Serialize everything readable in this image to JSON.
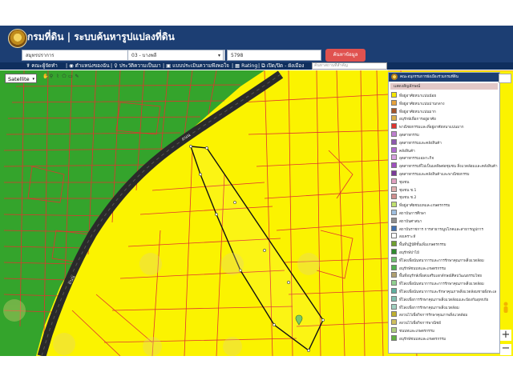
{
  "header": {
    "title": "กรมที่ดิน | ระบบค้นหารูปแปลงที่ดิน",
    "province_select": "สมุทรปราการ",
    "district_select": "03 - บางพลี",
    "parcel_number": "5798",
    "search_button": "ค้นหาข้อมูล"
  },
  "menu": {
    "items": [
      "คณะผู้จัดทำ",
      "ตำแหน่งของฉัน",
      "ประวัติความเป็นมา",
      "แบบประเมินความพึงพอใจ",
      "Rating",
      "เปิด/ปิด - ผังเมือง"
    ],
    "search_placeholder": "ค้นหาสถานที่สำคัญ"
  },
  "map": {
    "basemap_select": "Satellite",
    "road_label": "ถนน",
    "colors": {
      "zone_yellow": "#fbf300",
      "zone_green": "#34a42c",
      "parcel_lines": "#e0342f",
      "road": "#2a2a2a",
      "highlight": "#111111"
    }
  },
  "legend": {
    "title": "คณะอนุกรรมการผังเมืองร่วมกรมที่ดิน",
    "subtitle": "แสดงสัญลักษณ์",
    "items": [
      {
        "label": "ที่อยู่อาศัยหนาแน่นน้อย",
        "color": "#f5e700"
      },
      {
        "label": "ที่อยู่อาศัยหนาแน่นปานกลาง",
        "color": "#e6a23c"
      },
      {
        "label": "ที่อยู่อาศัยหนาแน่นมาก",
        "color": "#a5552a"
      },
      {
        "label": "อนุรักษ์เพื่อการอยู่อาศัย",
        "color": "#d9b04a"
      },
      {
        "label": "พาณิชยกรรมและที่อยู่อาศัยหนาแน่นมาก",
        "color": "#e0342f"
      },
      {
        "label": "อุตสาหกรรม",
        "color": "#c080d0"
      },
      {
        "label": "อุตสาหกรรมและคลังสินค้า",
        "color": "#8e5ab0"
      },
      {
        "label": "คลังสินค้า",
        "color": "#b06ad0"
      },
      {
        "label": "อุตสาหกรรมเฉพาะกิจ",
        "color": "#d8a0e0"
      },
      {
        "label": "อุตสาหกรรมที่ไม่เป็นมลพิษต่อชุมชน สิ่งแวดล้อมและคลังสินค้า",
        "color": "#a050c0"
      },
      {
        "label": "อุตสาหกรรมและคลังสินค้าและพาณิชยกรรม",
        "color": "#7a3a9a"
      },
      {
        "label": "ชุมชน",
        "color": "#e0a0c0"
      },
      {
        "label": "ชุมชน ช.1",
        "color": "#e0b0b0"
      },
      {
        "label": "ชุมชน ช.2",
        "color": "#d09090"
      },
      {
        "label": "ที่อยู่อาศัยชนบทและเกษตรกรรม",
        "color": "#c0e070"
      },
      {
        "label": "สถาบันการศึกษา",
        "color": "#a0c0e0"
      },
      {
        "label": "สถาบันศาสนา",
        "color": "#909090"
      },
      {
        "label": "สถาบันราชการ การสาธารณูปโภคและสาธารณูปการ",
        "color": "#4070b0"
      },
      {
        "label": "สงเคราะห์",
        "color": "#ffffff"
      },
      {
        "label": "พื้นที่ปฏิบัติชั้นเพิ่มเกษตรกรรม",
        "color": "#70a030"
      },
      {
        "label": "อนุรักษ์ป่าไม้",
        "color": "#2f8a2f"
      },
      {
        "label": "ที่โล่งเพื่อนันทนาการและการรักษาคุณภาพสิ่งแวดล้อม",
        "color": "#70c070"
      },
      {
        "label": "อนุรักษ์ชนบทและเกษตรกรรม",
        "color": "#50b050"
      },
      {
        "label": "พื้นที่อนุรักษ์เพื่อส่งเสริมเอกลักษณ์ศิลปวัฒนธรรมไทย",
        "color": "#b0a070"
      },
      {
        "label": "ที่โล่งเพื่อนันทนาการและการรักษาคุณภาพสิ่งแวดล้อม",
        "color": "#90d090"
      },
      {
        "label": "ที่โล่งเพื่อนันทนาการและรักษาคุณภาพสิ่งแวดล้อมชายฝั่งทะเล",
        "color": "#60b0a0"
      },
      {
        "label": "ที่โล่งเพื่อการรักษาคุณภาพสิ่งแวดล้อมและป้องกันอุทกภัย",
        "color": "#80c0b0"
      },
      {
        "label": "ที่โล่งเพื่อการรักษาคุณภาพสิ่งแวดล้อม",
        "color": "#a0d0c0"
      },
      {
        "label": "สงวนไว้เพื่อกิจการรักษาคุณภาพสิ่งแวดล้อม",
        "color": "#c0b030"
      },
      {
        "label": "สงวนไว้เพื่อกิจการพาณิชย์",
        "color": "#d0c060"
      },
      {
        "label": "ชนบทและเกษตรกรรม",
        "color": "#b0d080"
      },
      {
        "label": "อนุรักษ์ชนบทและเกษตรกรรม",
        "color": "#60b040"
      }
    ]
  }
}
